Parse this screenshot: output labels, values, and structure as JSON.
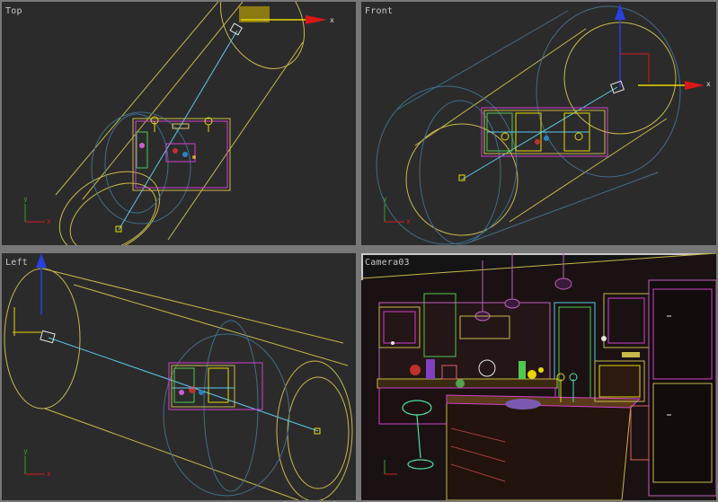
{
  "viewports": {
    "top": {
      "label": "Top",
      "gizmo_axis": "x",
      "corner_axes": [
        "y",
        "x"
      ]
    },
    "front": {
      "label": "Front",
      "gizmo_axis": "x",
      "corner_axes": [
        "y",
        "x"
      ]
    },
    "left": {
      "label": "Left",
      "corner_axes": [
        "y",
        "x"
      ]
    },
    "camera": {
      "label": "Camera03",
      "active": true
    }
  },
  "colors": {
    "viewport_bg": "#2b2b2b",
    "camera_bg": "#141414",
    "frame": "#777777",
    "light_cone": "#c8b84a",
    "light_sphere": "#3e6f8a",
    "target_line": "#5bc8e8",
    "axis_x": "#d81818",
    "axis_y": "#2a3fe0",
    "gizmo_yellow": "#e8d800"
  }
}
